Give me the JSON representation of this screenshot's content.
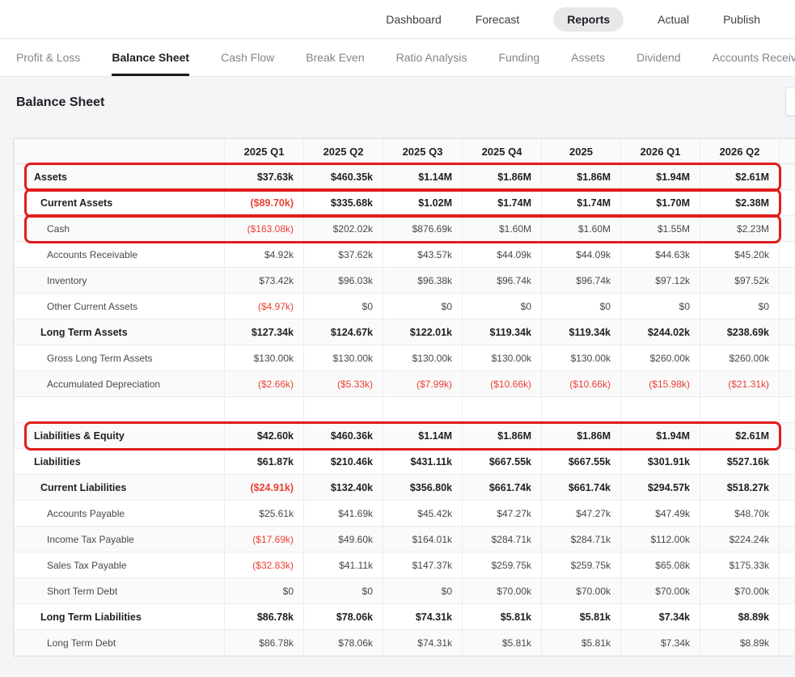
{
  "top_nav": {
    "items": [
      {
        "label": "Dashboard",
        "active": false
      },
      {
        "label": "Forecast",
        "active": false
      },
      {
        "label": "Reports",
        "active": true
      },
      {
        "label": "Actual",
        "active": false
      },
      {
        "label": "Publish",
        "active": false
      }
    ]
  },
  "tabs": {
    "items": [
      {
        "label": "Profit & Loss",
        "active": false
      },
      {
        "label": "Balance Sheet",
        "active": true
      },
      {
        "label": "Cash Flow",
        "active": false
      },
      {
        "label": "Break Even",
        "active": false
      },
      {
        "label": "Ratio Analysis",
        "active": false
      },
      {
        "label": "Funding",
        "active": false
      },
      {
        "label": "Assets",
        "active": false
      },
      {
        "label": "Dividend",
        "active": false
      },
      {
        "label": "Accounts Receivable",
        "active": false
      }
    ]
  },
  "page": {
    "title": "Balance Sheet"
  },
  "table": {
    "columns": [
      "",
      "2025 Q1",
      "2025 Q2",
      "2025 Q3",
      "2025 Q4",
      "2025",
      "2026 Q1",
      "2026 Q2",
      ""
    ],
    "rows": [
      {
        "label": "Assets",
        "level": 0,
        "bold": true,
        "values": [
          "$37.63k",
          "$460.35k",
          "$1.14M",
          "$1.86M",
          "$1.86M",
          "$1.94M",
          "$2.61M"
        ]
      },
      {
        "label": "Current Assets",
        "level": 1,
        "bold": true,
        "values": [
          "($89.70k)",
          "$335.68k",
          "$1.02M",
          "$1.74M",
          "$1.74M",
          "$1.70M",
          "$2.38M"
        ]
      },
      {
        "label": "Cash",
        "level": 2,
        "bold": false,
        "values": [
          "($163.08k)",
          "$202.02k",
          "$876.69k",
          "$1.60M",
          "$1.60M",
          "$1.55M",
          "$2.23M"
        ]
      },
      {
        "label": "Accounts Receivable",
        "level": 2,
        "bold": false,
        "values": [
          "$4.92k",
          "$37.62k",
          "$43.57k",
          "$44.09k",
          "$44.09k",
          "$44.63k",
          "$45.20k"
        ]
      },
      {
        "label": "Inventory",
        "level": 2,
        "bold": false,
        "values": [
          "$73.42k",
          "$96.03k",
          "$96.38k",
          "$96.74k",
          "$96.74k",
          "$97.12k",
          "$97.52k"
        ]
      },
      {
        "label": "Other Current Assets",
        "level": 2,
        "bold": false,
        "values": [
          "($4.97k)",
          "$0",
          "$0",
          "$0",
          "$0",
          "$0",
          "$0"
        ]
      },
      {
        "label": "Long Term Assets",
        "level": 1,
        "bold": true,
        "values": [
          "$127.34k",
          "$124.67k",
          "$122.01k",
          "$119.34k",
          "$119.34k",
          "$244.02k",
          "$238.69k"
        ]
      },
      {
        "label": "Gross Long Term Assets",
        "level": 2,
        "bold": false,
        "values": [
          "$130.00k",
          "$130.00k",
          "$130.00k",
          "$130.00k",
          "$130.00k",
          "$260.00k",
          "$260.00k"
        ]
      },
      {
        "label": "Accumulated Depreciation",
        "level": 2,
        "bold": false,
        "values": [
          "($2.66k)",
          "($5.33k)",
          "($7.99k)",
          "($10.66k)",
          "($10.66k)",
          "($15.98k)",
          "($21.31k)"
        ]
      },
      {
        "label": "",
        "level": 0,
        "bold": false,
        "values": [
          "",
          "",
          "",
          "",
          "",
          "",
          ""
        ]
      },
      {
        "label": "Liabilities & Equity",
        "level": 0,
        "bold": true,
        "values": [
          "$42.60k",
          "$460.36k",
          "$1.14M",
          "$1.86M",
          "$1.86M",
          "$1.94M",
          "$2.61M"
        ]
      },
      {
        "label": "Liabilities",
        "level": 0,
        "bold": true,
        "values": [
          "$61.87k",
          "$210.46k",
          "$431.11k",
          "$667.55k",
          "$667.55k",
          "$301.91k",
          "$527.16k"
        ]
      },
      {
        "label": "Current Liabilities",
        "level": 1,
        "bold": true,
        "values": [
          "($24.91k)",
          "$132.40k",
          "$356.80k",
          "$661.74k",
          "$661.74k",
          "$294.57k",
          "$518.27k"
        ]
      },
      {
        "label": "Accounts Payable",
        "level": 2,
        "bold": false,
        "values": [
          "$25.61k",
          "$41.69k",
          "$45.42k",
          "$47.27k",
          "$47.27k",
          "$47.49k",
          "$48.70k"
        ]
      },
      {
        "label": "Income Tax Payable",
        "level": 2,
        "bold": false,
        "values": [
          "($17.69k)",
          "$49.60k",
          "$164.01k",
          "$284.71k",
          "$284.71k",
          "$112.00k",
          "$224.24k"
        ]
      },
      {
        "label": "Sales Tax Payable",
        "level": 2,
        "bold": false,
        "values": [
          "($32.83k)",
          "$41.11k",
          "$147.37k",
          "$259.75k",
          "$259.75k",
          "$65.08k",
          "$175.33k"
        ]
      },
      {
        "label": "Short Term Debt",
        "level": 2,
        "bold": false,
        "values": [
          "$0",
          "$0",
          "$0",
          "$70.00k",
          "$70.00k",
          "$70.00k",
          "$70.00k"
        ]
      },
      {
        "label": "Long Term Liabilities",
        "level": 1,
        "bold": true,
        "values": [
          "$86.78k",
          "$78.06k",
          "$74.31k",
          "$5.81k",
          "$5.81k",
          "$7.34k",
          "$8.89k"
        ]
      },
      {
        "label": "Long Term Debt",
        "level": 2,
        "bold": false,
        "values": [
          "$86.78k",
          "$78.06k",
          "$74.31k",
          "$5.81k",
          "$5.81k",
          "$7.34k",
          "$8.89k"
        ]
      }
    ]
  },
  "annotations": {
    "color": "#e11c1c",
    "highlighted_rows": [
      "Assets",
      "Current Assets",
      "Cash",
      "Liabilities & Equity"
    ]
  },
  "colors": {
    "negative_value": "#e94235",
    "active_tab_underline": "#1b1b1b",
    "active_pill_bg": "#e7e8ea"
  }
}
